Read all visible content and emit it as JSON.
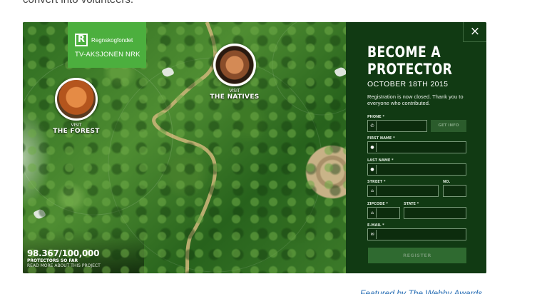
{
  "intro": {
    "text": "convert into volunteers."
  },
  "card": {
    "logo": {
      "mark": "R",
      "org": "Regnskogfondet",
      "sub": "TV-AKSJONEN NRK"
    },
    "hotspots": [
      {
        "small": "VISIT",
        "big": "THE FOREST"
      },
      {
        "small": "VISIT",
        "big": "THE NATIVES"
      }
    ],
    "counter": {
      "value": "98.367/100,000",
      "label": "PROTECTORS SO FAR",
      "link": "READ MORE ABOUT THIS PROJECT"
    },
    "form": {
      "close": "×",
      "title": "BECOME A PROTECTOR",
      "date": "OCTOBER 18TH 2015",
      "note": "Registration is now closed. Thank you to everyone who contributed.",
      "fields": {
        "phone": {
          "label": "PHONE *",
          "icon": "phone-icon"
        },
        "first_name": {
          "label": "FIRST NAME *",
          "icon": "person-icon"
        },
        "last_name": {
          "label": "LAST NAME *",
          "icon": "person-icon"
        },
        "street": {
          "label": "STREET *",
          "icon": "home-icon"
        },
        "no": {
          "label": "NO."
        },
        "zipcode": {
          "label": "ZIPCODE *",
          "icon": "home-icon"
        },
        "state": {
          "label": "STATE *"
        },
        "email": {
          "label": "E-MAIL *",
          "icon": "mail-icon"
        }
      },
      "get_info": "GET INFO",
      "register": "REGISTER"
    }
  },
  "caption": {
    "text": "Featured by The Webby Awards"
  },
  "colors": {
    "panel": "#113a13",
    "logo_green": "#4caf3e",
    "link_blue": "#2a6fb5"
  }
}
